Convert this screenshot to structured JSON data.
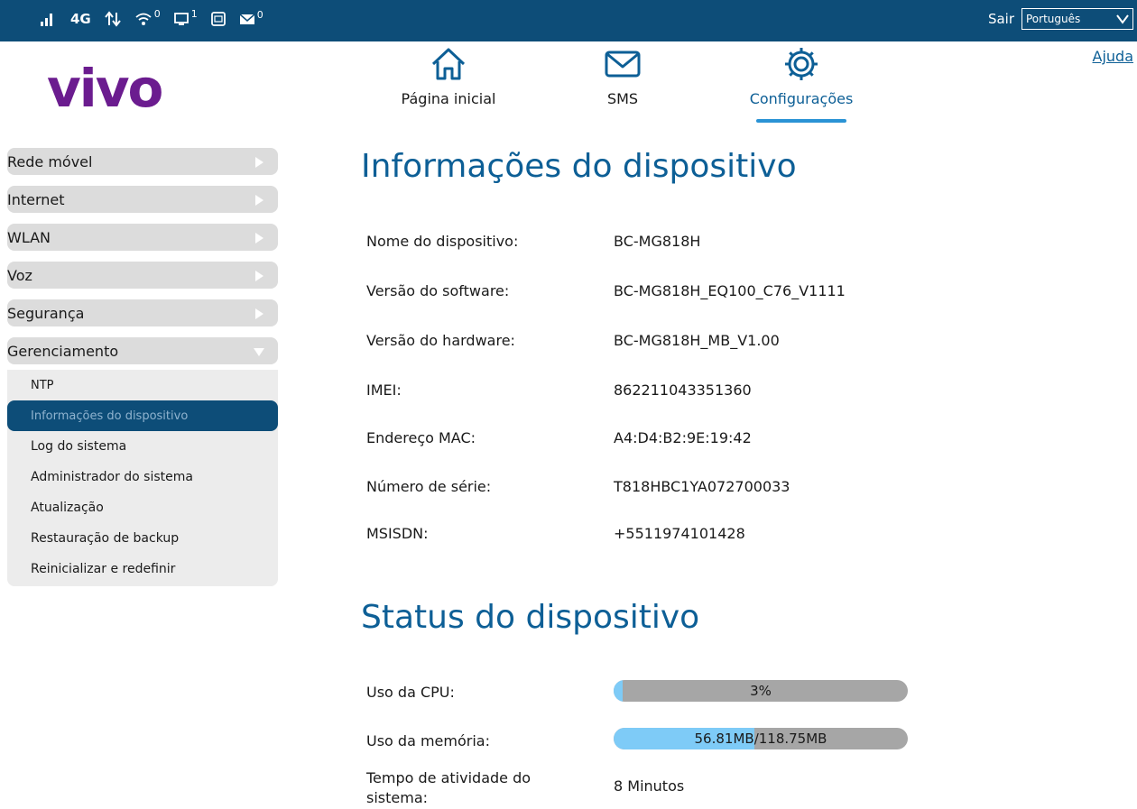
{
  "status_bar": {
    "network_type": "4G",
    "wifi_count": "0",
    "devices_count": "1",
    "sms_count": "0",
    "logout_label": "Sair",
    "language": "Português"
  },
  "header": {
    "logo_text": "vivo",
    "help_label": "Ajuda"
  },
  "nav": {
    "home": "Página inicial",
    "sms": "SMS",
    "settings": "Configurações"
  },
  "sidebar": {
    "menus": [
      "Rede móvel",
      "Internet",
      "WLAN",
      "Voz",
      "Segurança",
      "Gerenciamento"
    ],
    "submenu": [
      "NTP",
      "Informações do dispositivo",
      "Log do sistema",
      "Administrador do sistema",
      "Atualização",
      "Restauração de backup",
      "Reinicializar e redefinir"
    ]
  },
  "device_info": {
    "title": "Informações do dispositivo",
    "rows": [
      {
        "label": "Nome do dispositivo:",
        "value": "BC-MG818H"
      },
      {
        "label": "Versão do software:",
        "value": "BC-MG818H_EQ100_C76_V1111"
      },
      {
        "label": "Versão do hardware:",
        "value": "BC-MG818H_MB_V1.00"
      },
      {
        "label": "IMEI:",
        "value": "862211043351360"
      },
      {
        "label": "Endereço MAC:",
        "value": "A4:D4:B2:9E:19:42"
      },
      {
        "label": "Número de série:",
        "value": "T818HBC1YA072700033"
      },
      {
        "label": "MSISDN:",
        "value": "+5511974101428"
      }
    ]
  },
  "device_status": {
    "title": "Status do dispositivo",
    "cpu_label": "Uso da CPU:",
    "cpu_value": "3%",
    "cpu_fraction": 0.03,
    "memory_label": "Uso da memória:",
    "memory_value": "56.81MB/118.75MB",
    "memory_fraction": 0.478,
    "uptime_label_line1": "Tempo de atividade do",
    "uptime_label_line2": "sistema:",
    "uptime_value": "8 Minutos"
  },
  "colors": {
    "topbar": "#0d4d78",
    "brand": "#6b1c8f",
    "accent": "#0d5f96",
    "bar_fill": "#7ecbf7"
  }
}
